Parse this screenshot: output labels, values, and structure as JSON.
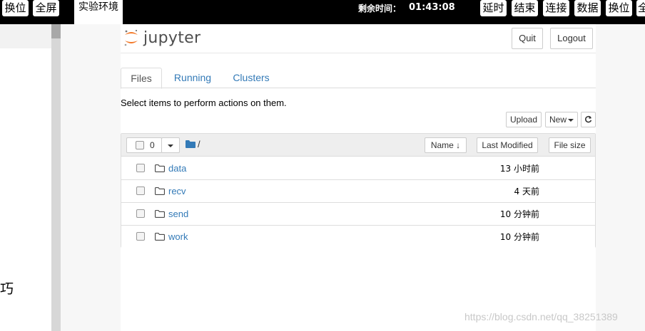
{
  "topbar": {
    "left_buttons": [
      "换位",
      "全屏"
    ],
    "active_tab": "实验环境",
    "timer_label": "剩余时间：",
    "timer_value": "01:43:08",
    "right_buttons": [
      "延时",
      "结束",
      "连接",
      "数据",
      "换位",
      "全"
    ]
  },
  "left_panel": {
    "text": "巧"
  },
  "jupyter": {
    "logo_text": "jupyter",
    "quit_label": "Quit",
    "logout_label": "Logout",
    "tabs": [
      "Files",
      "Running",
      "Clusters"
    ],
    "message": "Select items to perform actions on them.",
    "upload_label": "Upload",
    "new_label": "New",
    "list_header": {
      "selected_count": "0",
      "path": "/",
      "sort_name": "Name",
      "last_modified": "Last Modified",
      "file_size": "File size"
    },
    "files": [
      {
        "name": "data",
        "modified": "13 小时前"
      },
      {
        "name": "recv",
        "modified": "4 天前"
      },
      {
        "name": "send",
        "modified": "10 分钟前"
      },
      {
        "name": "work",
        "modified": "10 分钟前"
      }
    ]
  },
  "watermark": "https://blog.csdn.net/qq_38251389",
  "colors": {
    "link": "#337ab7",
    "topbar": "#000000",
    "jupyter_orange": "#f37726"
  }
}
